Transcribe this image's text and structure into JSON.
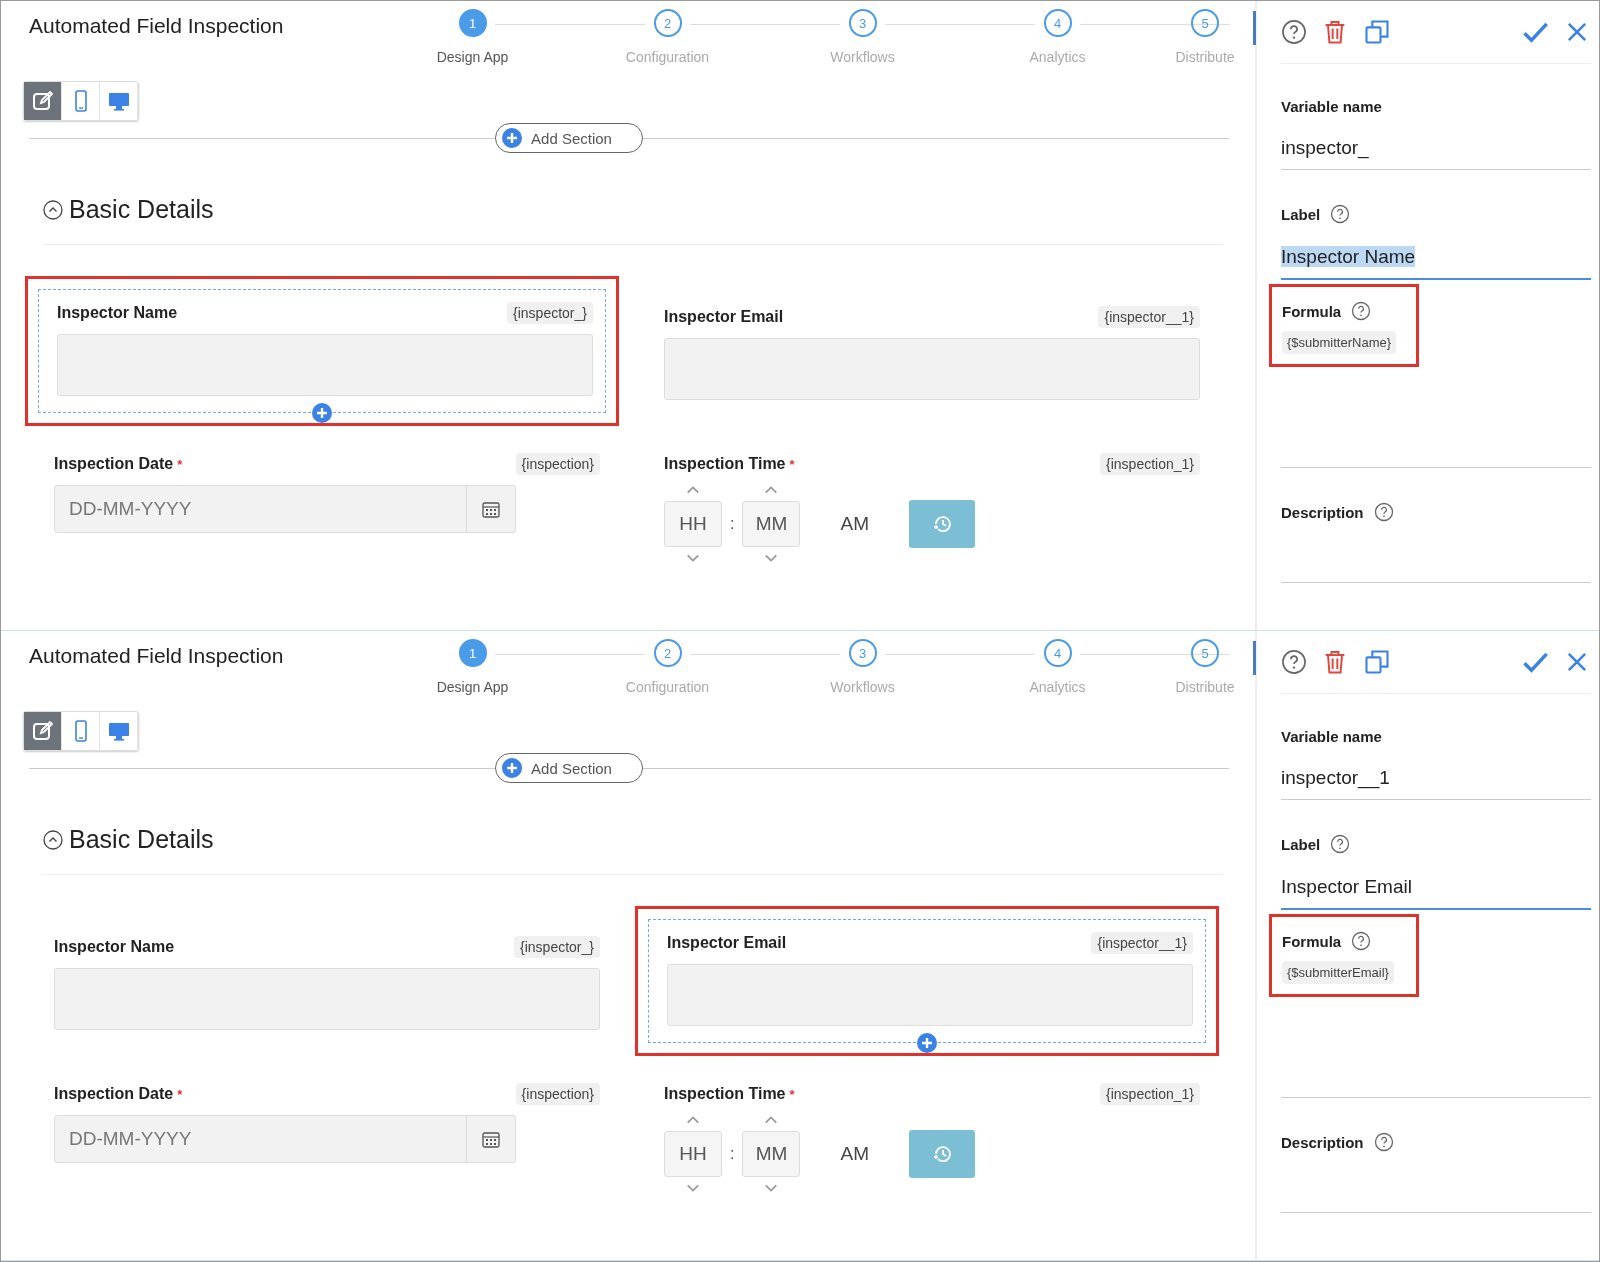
{
  "panels": [
    {
      "title": "Automated Field Inspection",
      "steps": [
        {
          "number": "1",
          "label": "Design App",
          "selected": true
        },
        {
          "number": "2",
          "label": "Configuration",
          "selected": false
        },
        {
          "number": "3",
          "label": "Workflows",
          "selected": false
        },
        {
          "number": "4",
          "label": "Analytics",
          "selected": false
        },
        {
          "number": "5",
          "label": "Distribute",
          "selected": false
        }
      ],
      "view_modes": [
        {
          "kind": "edit",
          "selected": true
        },
        {
          "kind": "mobile",
          "selected": false
        },
        {
          "kind": "desktop",
          "selected": false
        }
      ],
      "add_section": "Add Section",
      "section_title": "Basic Details",
      "fields": [
        {
          "kind": "text",
          "label": "Inspector Name",
          "variable": "{inspector_}",
          "selected": true
        },
        {
          "kind": "text",
          "label": "Inspector Email",
          "variable": "{inspector__1}",
          "selected": false
        },
        {
          "kind": "date",
          "label": "Inspection Date",
          "variable": "{inspection}",
          "required_mark": "*",
          "selected": false,
          "placeholder": "DD-MM-YYYY"
        },
        {
          "kind": "time",
          "label": "Inspection Time",
          "variable": "{inspection_1}",
          "required_mark": "*",
          "selected": false,
          "hours": "HH",
          "separator": ":",
          "minutes": "MM",
          "period": "AM"
        }
      ],
      "properties": {
        "variable_name_label": "Variable name",
        "variable_name": "inspector_",
        "label_label": "Label",
        "label": "Inspector Name",
        "label_text_selected": true,
        "formula_label": "Formula",
        "formula": "{$submitterName}",
        "formula_highlighted": true,
        "description_label": "Description"
      }
    },
    {
      "title": "Automated Field Inspection",
      "steps": [
        {
          "number": "1",
          "label": "Design App",
          "selected": true
        },
        {
          "number": "2",
          "label": "Configuration",
          "selected": false
        },
        {
          "number": "3",
          "label": "Workflows",
          "selected": false
        },
        {
          "number": "4",
          "label": "Analytics",
          "selected": false
        },
        {
          "number": "5",
          "label": "Distribute",
          "selected": false
        }
      ],
      "view_modes": [
        {
          "kind": "edit",
          "selected": true
        },
        {
          "kind": "mobile",
          "selected": false
        },
        {
          "kind": "desktop",
          "selected": false
        }
      ],
      "add_section": "Add Section",
      "section_title": "Basic Details",
      "fields": [
        {
          "kind": "text",
          "label": "Inspector Name",
          "variable": "{inspector_}",
          "selected": false
        },
        {
          "kind": "text",
          "label": "Inspector Email",
          "variable": "{inspector__1}",
          "selected": true
        },
        {
          "kind": "date",
          "label": "Inspection Date",
          "variable": "{inspection}",
          "required_mark": "*",
          "selected": false,
          "placeholder": "DD-MM-YYYY"
        },
        {
          "kind": "time",
          "label": "Inspection Time",
          "variable": "{inspection_1}",
          "required_mark": "*",
          "selected": false,
          "hours": "HH",
          "separator": ":",
          "minutes": "MM",
          "period": "AM"
        }
      ],
      "properties": {
        "variable_name_label": "Variable name",
        "variable_name": "inspector__1",
        "label_label": "Label",
        "label": "Inspector Email",
        "label_text_selected": false,
        "formula_label": "Formula",
        "formula": "{$submitterEmail}",
        "formula_highlighted": true,
        "description_label": "Description"
      }
    }
  ]
}
